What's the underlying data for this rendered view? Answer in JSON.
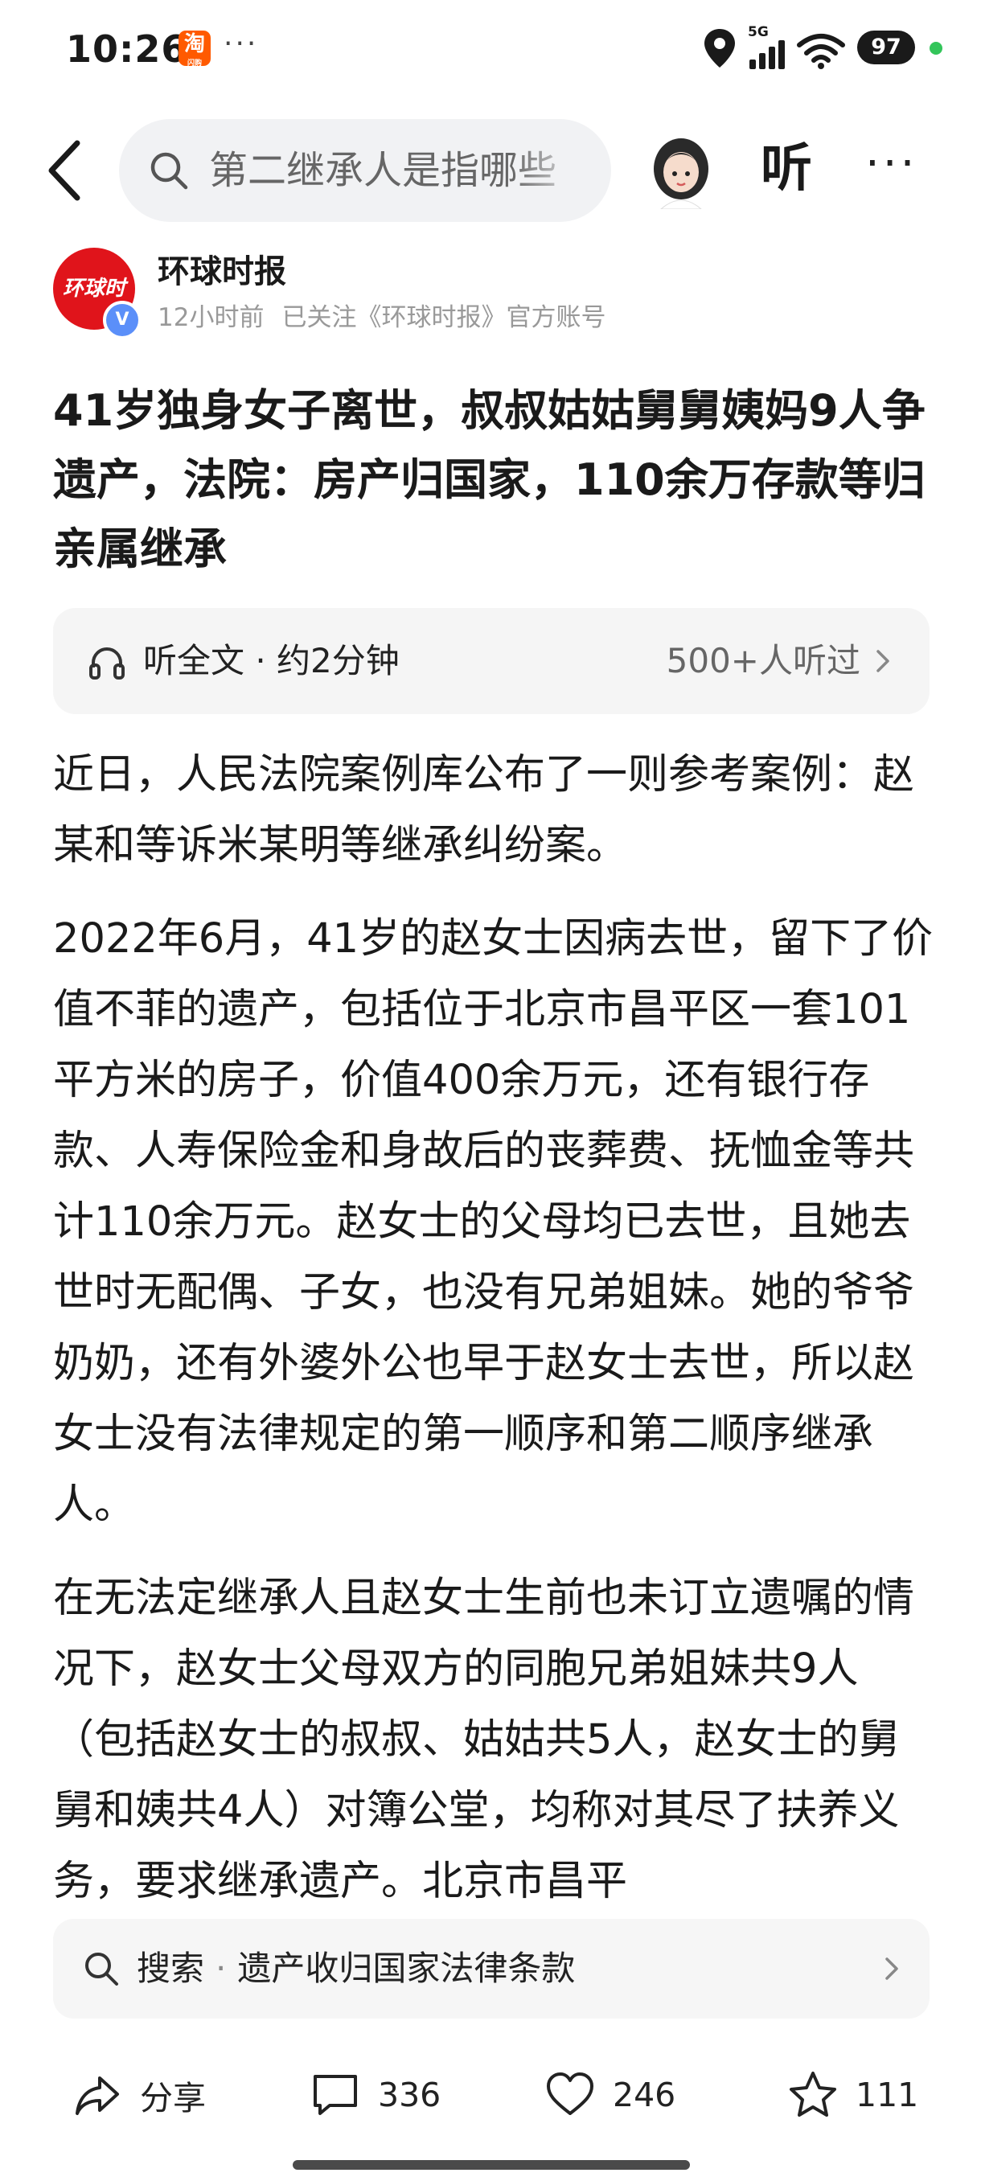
{
  "status_bar": {
    "time": "10:26",
    "app_badge": "淘",
    "app_badge_sub": "闪购",
    "more": "···",
    "network": "5G",
    "battery": "97",
    "colors": {
      "battery_bg": "#1a1a1a",
      "dot": "#33c55a",
      "taobao": "#ff5a00"
    }
  },
  "nav": {
    "search_text": "第二继承人是指哪些",
    "listen_label": "听",
    "more_label": "···",
    "icons": [
      "back-icon",
      "search-icon",
      "avatar",
      "more-icon"
    ]
  },
  "author": {
    "logo_text": "环球时报",
    "verified_badge": "V",
    "name": "环球时报",
    "time": "12小时前",
    "follow_note": "已关注《环球时报》官方账号"
  },
  "article": {
    "title": "41岁独身女子离世，叔叔姑姑舅舅姨妈9人争遗产，法院：房产归国家，110余万存款等归亲属继承",
    "listen": {
      "label": "听全文 · 约2分钟",
      "listeners": "500+人听过"
    },
    "paragraphs": [
      "近日，人民法院案例库公布了一则参考案例：赵某和等诉米某明等继承纠纷案。",
      "2022年6月，41岁的赵女士因病去世，留下了价值不菲的遗产，包括位于北京市昌平区一套101平方米的房子，价值400余万元，还有银行存款、人寿保险金和身故后的丧葬费、抚恤金等共计110余万元。赵女士的父母均已去世，且她去世时无配偶、子女，也没有兄弟姐妹。她的爷爷奶奶，还有外婆外公也早于赵女士去世，所以赵女士没有法律规定的第一顺序和第二顺序继承人。",
      "在无法定继承人且赵女士生前也未订立遗嘱的情况下，赵女士父母双方的同胞兄弟姐妹共9人（包括赵女士的叔叔、姑姑共5人，赵女士的舅舅和姨共4人）对簿公堂，均称对其尽了扶养义务，要求继承遗产。北京市昌平"
    ]
  },
  "search_suggestion": {
    "prefix": "搜索",
    "separator": "·",
    "query": "遗产收归国家法律条款"
  },
  "bottom_bar": {
    "share": "分享",
    "comments": "336",
    "likes": "246",
    "favorites": "111"
  }
}
